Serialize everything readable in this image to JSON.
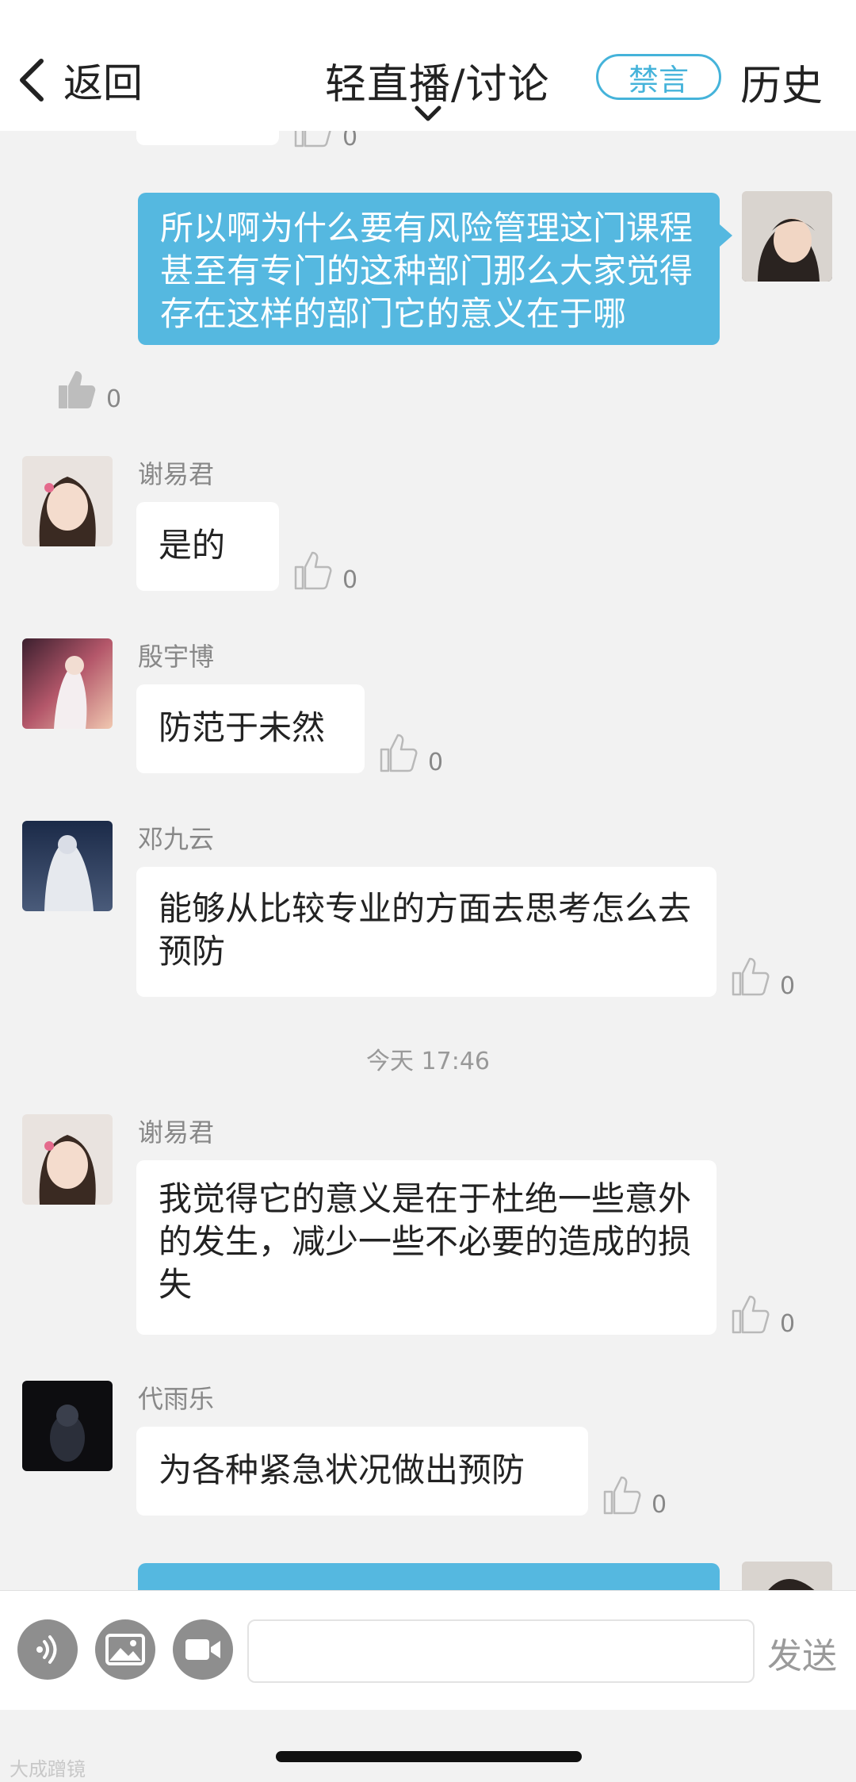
{
  "header": {
    "back_label": "返回",
    "title": "轻直播/讨论",
    "mute_label": "禁言",
    "history_label": "历史"
  },
  "messages": [
    {
      "text": "所以啊为什么要有风险管理这门课程甚至有专门的这种部门那么大家觉得存在这样的部门它的意义在于哪",
      "likes": "0"
    },
    {
      "sender": "谢易君",
      "text": "是的",
      "likes": "0"
    },
    {
      "sender": "殷宇博",
      "text": "防范于未然",
      "likes": "0"
    },
    {
      "sender": "邓九云",
      "text": "能够从比较专业的方面去思考怎么去预防",
      "likes": "0"
    },
    {
      "sender": "谢易君",
      "text": "我觉得它的意义是在于杜绝一些意外的发生，减少一些不必要的造成的损失",
      "likes": "0"
    },
    {
      "sender": "代雨乐",
      "text": "为各种紧急状况做出预防",
      "likes": "0"
    }
  ],
  "top_partial_likes": "0",
  "timestamp": "今天 17:46",
  "input": {
    "send_label": "发送",
    "placeholder": ""
  },
  "watermark": "大成蹭镜",
  "colors": {
    "accent": "#45b3da",
    "my_bubble": "#55b8e0",
    "background": "#f2f2f2"
  }
}
